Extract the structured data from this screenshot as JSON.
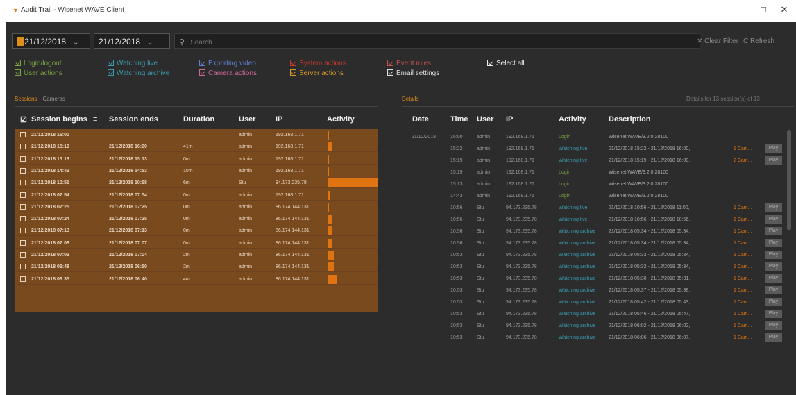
{
  "titlebar": {
    "title": "Audit Trail - Wisenet WAVE Client",
    "minimize": "—",
    "maximize": "□",
    "close": "✕"
  },
  "filter": {
    "date_from": "21/12/2018",
    "date_to": "21/12/2018",
    "search_placeholder": "Search",
    "clear_filter": "✕ Clear Filter",
    "refresh": "C Refresh"
  },
  "activity_filters": [
    {
      "label": "Login/logout",
      "color": "#7aa342"
    },
    {
      "label": "User actions",
      "color": "#7aa342"
    },
    {
      "label": "Watching live",
      "color": "#3a9bb0"
    },
    {
      "label": "Watching archive",
      "color": "#3a9bb0"
    },
    {
      "label": "Exporting video",
      "color": "#5f7fd0"
    },
    {
      "label": "Camera actions",
      "color": "#d0689a"
    },
    {
      "label": "System actions",
      "color": "#c0392b"
    },
    {
      "label": "Server actions",
      "color": "#d49a2b"
    },
    {
      "label": "Event rules",
      "color": "#c05050"
    },
    {
      "label": "Email settings",
      "color": "#dddddd"
    },
    {
      "label": "Select all",
      "color": "#eeeeee"
    }
  ],
  "left_tabs": [
    "Sessions",
    "Cameras"
  ],
  "right_tab": "Details",
  "details_summary": "Details for 13 session(s) of 13",
  "sessions_columns": [
    "Session begins",
    "Session ends",
    "Duration",
    "User",
    "IP",
    "Activity"
  ],
  "sessions": [
    {
      "begins": "21/12/2018 16:00",
      "ends": "",
      "duration": "",
      "user": "admin",
      "ip": "192.168.1.71",
      "activity": 0.02
    },
    {
      "begins": "21/12/2018 15:19",
      "ends": "21/12/2018 16:00",
      "duration": "41m",
      "user": "admin",
      "ip": "192.168.1.71",
      "activity": 0.1
    },
    {
      "begins": "21/12/2018 15:13",
      "ends": "21/12/2018 15:13",
      "duration": "0m",
      "user": "admin",
      "ip": "192.168.1.71",
      "activity": 0.02
    },
    {
      "begins": "21/12/2018 14:43",
      "ends": "21/12/2018 14:53",
      "duration": "10m",
      "user": "admin",
      "ip": "192.168.1.71",
      "activity": 0.02
    },
    {
      "begins": "21/12/2018 10:51",
      "ends": "21/12/2018 10:58",
      "duration": "6m",
      "user": "Stu",
      "ip": "94.173.235.78",
      "activity": 1.0
    },
    {
      "begins": "21/12/2018 07:54",
      "ends": "21/12/2018 07:54",
      "duration": "0m",
      "user": "admin",
      "ip": "192.168.1.71",
      "activity": 0.04
    },
    {
      "begins": "21/12/2018 07:25",
      "ends": "21/12/2018 07:25",
      "duration": "0m",
      "user": "admin",
      "ip": "86.174.144.131",
      "activity": 0.02
    },
    {
      "begins": "21/12/2018 07:24",
      "ends": "21/12/2018 07:25",
      "duration": "0m",
      "user": "admin",
      "ip": "86.174.144.131",
      "activity": 0.1
    },
    {
      "begins": "21/12/2018 07:13",
      "ends": "21/12/2018 07:13",
      "duration": "0m",
      "user": "admin",
      "ip": "86.174.144.131",
      "activity": 0.1
    },
    {
      "begins": "21/12/2018 07:06",
      "ends": "21/12/2018 07:07",
      "duration": "0m",
      "user": "admin",
      "ip": "86.174.144.131",
      "activity": 0.1
    },
    {
      "begins": "21/12/2018 07:03",
      "ends": "21/12/2018 07:04",
      "duration": "2m",
      "user": "admin",
      "ip": "86.174.144.131",
      "activity": 0.13
    },
    {
      "begins": "21/12/2018 06:48",
      "ends": "21/12/2018 06:50",
      "duration": "2m",
      "user": "admin",
      "ip": "86.174.144.131",
      "activity": 0.13
    },
    {
      "begins": "21/12/2018 06:35",
      "ends": "21/12/2018 06:40",
      "duration": "4m",
      "user": "admin",
      "ip": "86.174.144.131",
      "activity": 0.2
    }
  ],
  "details_columns": [
    "Date",
    "Time",
    "User",
    "IP",
    "Activity",
    "Description"
  ],
  "details": [
    {
      "date": "21/12/2018",
      "time": "16:00",
      "user": "admin",
      "ip": "192.168.1.71",
      "activity": "Login",
      "color": "#7aa342",
      "desc": "Wisenet WAVE/3.2.0.28100",
      "cam": "",
      "play": false
    },
    {
      "date": "",
      "time": "15:22",
      "user": "admin",
      "ip": "192.168.1.71",
      "activity": "Watching live",
      "color": "#3a9bb0",
      "desc": "21/12/2018 15:22 - 21/12/2018 16:00,",
      "cam": "1 Cam...",
      "play": true
    },
    {
      "date": "",
      "time": "15:19",
      "user": "admin",
      "ip": "192.168.1.71",
      "activity": "Watching live",
      "color": "#3a9bb0",
      "desc": "21/12/2018 15:19 - 21/12/2018 16:00,",
      "cam": "2 Cam...",
      "play": true
    },
    {
      "date": "",
      "time": "15:19",
      "user": "admin",
      "ip": "192.168.1.71",
      "activity": "Login",
      "color": "#7aa342",
      "desc": "Wisenet WAVE/3.2.0.28100",
      "cam": "",
      "play": false
    },
    {
      "date": "",
      "time": "15:13",
      "user": "admin",
      "ip": "192.168.1.71",
      "activity": "Login",
      "color": "#7aa342",
      "desc": "Wisenet WAVE/3.2.0.28100",
      "cam": "",
      "play": false
    },
    {
      "date": "",
      "time": "14:43",
      "user": "admin",
      "ip": "192.168.1.71",
      "activity": "Login",
      "color": "#7aa342",
      "desc": "Wisenet WAVE/3.2.0.28100",
      "cam": "",
      "play": false
    },
    {
      "date": "",
      "time": "10:56",
      "user": "Stu",
      "ip": "94.173.235.78",
      "activity": "Watching live",
      "color": "#3a9bb0",
      "desc": "21/12/2018 10:56 - 21/12/2018 11:00,",
      "cam": "1 Cam...",
      "play": true
    },
    {
      "date": "",
      "time": "10:56",
      "user": "Stu",
      "ip": "94.173.235.78",
      "activity": "Watching live",
      "color": "#3a9bb0",
      "desc": "21/12/2018 10:56 - 21/12/2018 10:56,",
      "cam": "1 Cam...",
      "play": true
    },
    {
      "date": "",
      "time": "10:56",
      "user": "Stu",
      "ip": "94.173.235.78",
      "activity": "Watching archive",
      "color": "#3a9bb0",
      "desc": "21/12/2018 05:34 - 21/12/2018 05:34,",
      "cam": "1 Cam...",
      "play": true
    },
    {
      "date": "",
      "time": "10:56",
      "user": "Stu",
      "ip": "94.173.235.78",
      "activity": "Watching archive",
      "color": "#3a9bb0",
      "desc": "21/12/2018 05:34 - 21/12/2018 05:34,",
      "cam": "1 Cam...",
      "play": true
    },
    {
      "date": "",
      "time": "10:53",
      "user": "Stu",
      "ip": "94.173.235.78",
      "activity": "Watching archive",
      "color": "#3a9bb0",
      "desc": "21/12/2018 05:33 - 21/12/2018 05:34,",
      "cam": "1 Cam...",
      "play": true
    },
    {
      "date": "",
      "time": "10:53",
      "user": "Stu",
      "ip": "94.173.235.78",
      "activity": "Watching archive",
      "color": "#3a9bb0",
      "desc": "21/12/2018 05:32 - 21/12/2018 05:34,",
      "cam": "1 Cam...",
      "play": true
    },
    {
      "date": "",
      "time": "10:53",
      "user": "Stu",
      "ip": "94.173.235.78",
      "activity": "Watching archive",
      "color": "#3a9bb0",
      "desc": "21/12/2018 05:30 - 21/12/2018 05:31,",
      "cam": "1 Cam...",
      "play": true
    },
    {
      "date": "",
      "time": "10:53",
      "user": "Stu",
      "ip": "94.173.235.78",
      "activity": "Watching archive",
      "color": "#3a9bb0",
      "desc": "21/12/2018 05:37 - 21/12/2018 05:38,",
      "cam": "1 Cam...",
      "play": true
    },
    {
      "date": "",
      "time": "10:53",
      "user": "Stu",
      "ip": "94.173.235.78",
      "activity": "Watching archive",
      "color": "#3a9bb0",
      "desc": "21/12/2018 05:42 - 21/12/2018 05:43,",
      "cam": "1 Cam...",
      "play": true
    },
    {
      "date": "",
      "time": "10:53",
      "user": "Stu",
      "ip": "94.173.235.78",
      "activity": "Watching archive",
      "color": "#3a9bb0",
      "desc": "21/12/2018 05:46 - 21/12/2018 05:47,",
      "cam": "1 Cam...",
      "play": true
    },
    {
      "date": "",
      "time": "10:53",
      "user": "Stu",
      "ip": "94.173.235.78",
      "activity": "Watching archive",
      "color": "#3a9bb0",
      "desc": "21/12/2018 06:02 - 21/12/2018 06:02,",
      "cam": "1 Cam...",
      "play": true
    },
    {
      "date": "",
      "time": "10:53",
      "user": "Stu",
      "ip": "94.173.235.78",
      "activity": "Watching archive",
      "color": "#3a9bb0",
      "desc": "21/12/2018 06:06 - 21/12/2018 06:07,",
      "cam": "1 Cam...",
      "play": true
    }
  ],
  "play_label": "Play"
}
